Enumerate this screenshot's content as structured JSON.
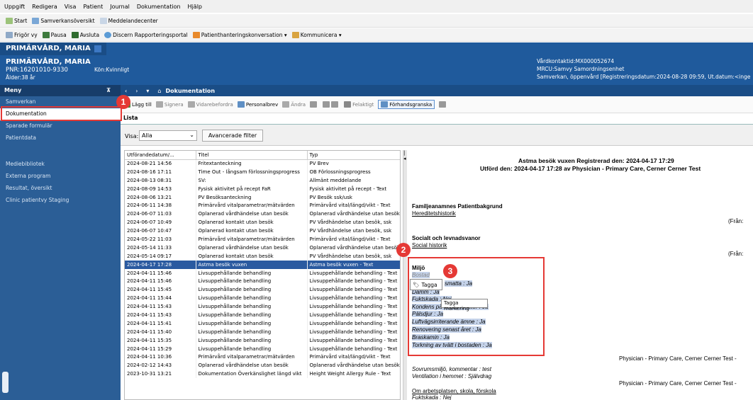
{
  "menubar": [
    "Uppgift",
    "Redigera",
    "Visa",
    "Patient",
    "Journal",
    "Dokumentation",
    "Hjälp"
  ],
  "toolbar1": [
    {
      "label": "Start",
      "icon": "home-icon"
    },
    {
      "label": "Samverkansöversikt",
      "icon": "overview-icon"
    },
    {
      "label": "Meddelandecenter",
      "icon": "message-icon"
    }
  ],
  "toolbar2": [
    {
      "label": "Frigör vy",
      "icon": "release-icon"
    },
    {
      "label": "Pausa",
      "icon": "pause-icon"
    },
    {
      "label": "Avsluta",
      "icon": "exit-icon"
    },
    {
      "label": "Discern Rapporteringsportal",
      "icon": "report-icon"
    },
    {
      "label": "Patienthanteringskonversation ▾",
      "icon": "patient-icon"
    },
    {
      "label": "Kommunicera ▾",
      "icon": "communicate-icon"
    }
  ],
  "banner": {
    "tab_name": "PRIMÄRVÅRD, MARIA",
    "patient_name": "PRIMÄRVÅRD, MARIA",
    "pnr": "PNR:16201010-9330",
    "kon": "Kön:Kvinnligt",
    "age": "Ålder:38 år",
    "vardkontakt": "Vårdkontaktid:MX000052674",
    "mrcu": "MRCU:Samvy Samordningsenhet",
    "samverkan": "Samverkan, öppenvård [Registreringsdatum:2024-08-28 09:59, Ut.datum:<inge"
  },
  "nav": {
    "header": "Meny",
    "pin": "⊼",
    "items": [
      "Samverkan",
      "Dokumentation",
      "Sparade formulär",
      "Patientdata",
      "Mediebibliotek",
      "Externa program",
      "Resultat, översikt",
      "Clinic patientvy Staging"
    ]
  },
  "crumb": {
    "back": "‹",
    "forward": "›",
    "dropdown": "▾",
    "home": "⌂",
    "title": "Dokumentation"
  },
  "doc_toolbar": {
    "add": "Lägg till",
    "sign": "Signera",
    "forward": "Vidarebefordra",
    "letter": "Personalbrev",
    "change": "Ändra",
    "incorrect": "Felaktigt",
    "preview": "Förhandsgranska"
  },
  "tab_lista": "Lista",
  "filter": {
    "label": "Visa:",
    "value": "Alla",
    "advanced": "Avancerade filter"
  },
  "table": {
    "headers": [
      "Utförandedatum/...",
      "Titel",
      "Typ"
    ],
    "rows": [
      [
        "2024-08-21 14:56",
        "Fritextanteckning",
        "PV Brev"
      ],
      [
        "2024-08-16 17:11",
        "Time Out - långsam förlossningsprogress",
        "OB Förlossningsprogress"
      ],
      [
        "2024-08-13 08:31",
        "SV:",
        "Allmänt meddelande"
      ],
      [
        "2024-08-09 14:53",
        "Fysisk aktivitet på recept FaR",
        "Fysisk aktivitet på recept - Text"
      ],
      [
        "2024-08-06 13:21",
        "PV Besöksanteckning",
        "PV Besök ssk/usk"
      ],
      [
        "2024-06-11 14:38",
        "Primärvård vitalparametrar/mätvärden",
        "Primärvård vital/längd/vikt - Text"
      ],
      [
        "2024-06-07 11:03",
        "Oplanerad vårdhändelse utan besök",
        "Oplanerad vårdhändelse utan besök -"
      ],
      [
        "2024-06-07 10:49",
        "Oplanerad kontakt utan besök",
        "PV Vårdhändelse utan besök, ssk"
      ],
      [
        "2024-06-07 10:47",
        "Oplanerad kontakt utan besök",
        "PV Vårdhändelse utan besök, ssk"
      ],
      [
        "2024-05-22 11:03",
        "Primärvård vitalparametrar/mätvärden",
        "Primärvård vital/längd/vikt - Text"
      ],
      [
        "2024-05-14 11:33",
        "Oplanerad vårdhändelse utan besök",
        "Oplanerad vårdhändelse utan besök"
      ],
      [
        "2024-05-14 09:17",
        "Oplanerad kontakt utan besök",
        "PV Vårdhändelse utan besök, ssk"
      ],
      [
        "2024-04-17 17:28",
        "Astma besök vuxen",
        "Astma besök vuxen - Text"
      ],
      [
        "2024-04-11 15:46",
        "Livsuppehållande behandling",
        "Livsuppehållande behandling - Text"
      ],
      [
        "2024-04-11 15:46",
        "Livsuppehållande behandling",
        "Livsuppehållande behandling - Text"
      ],
      [
        "2024-04-11 15:45",
        "Livsuppehållande behandling",
        "Livsuppehållande behandling - Text"
      ],
      [
        "2024-04-11 15:44",
        "Livsuppehållande behandling",
        "Livsuppehållande behandling - Text"
      ],
      [
        "2024-04-11 15:43",
        "Livsuppehållande behandling",
        "Livsuppehållande behandling - Text"
      ],
      [
        "2024-04-11 15:43",
        "Livsuppehållande behandling",
        "Livsuppehållande behandling - Text"
      ],
      [
        "2024-04-11 15:41",
        "Livsuppehållande behandling",
        "Livsuppehållande behandling - Text"
      ],
      [
        "2024-04-11 15:40",
        "Livsuppehållande behandling",
        "Livsuppehållande behandling - Text"
      ],
      [
        "2024-04-11 15:35",
        "Livsuppehållande behandling",
        "Livsuppehållande behandling - Text"
      ],
      [
        "2024-04-11 15:29",
        "Livsuppehållande behandling",
        "Livsuppehållande behandling - Text"
      ],
      [
        "2024-04-11 10:36",
        "Primärvård vitalparametrar/mätvärden",
        "Primärvård vital/längd/vikt - Text"
      ],
      [
        "2024-02-12 14:43",
        "Oplanerad vårdhändelse utan besök",
        "Oplanerad vårdhändelse utan besök -"
      ],
      [
        "2023-10-31 13:21",
        "Dokumentation Överkänslighet längd vikt",
        "Height Weight Allergy Rule - Text"
      ]
    ],
    "selected_index": 12
  },
  "preview": {
    "title1": "Astma besök vuxen Registrerad den:  2024-04-17 17:29",
    "title2": "Utförd den:  2024-04-17 17:28  av Physician - Primary Care, Cerner Cerner Test",
    "section1": "Familjeanamnes Patientbakgrund",
    "link1": "Hereditetshistorik",
    "fran1": "(Från: ",
    "section2": "Socialt och levnadsvanor",
    "link2": "Social historik",
    "fran2": "(Från: ",
    "section3": "Miljö",
    "hidden_row": "Bostad",
    "env_items": [
      "smatta :  Ja",
      "Damm :  Ja",
      "Fuktskada :  Nej",
      "Kondens på insida fönster :  Ja",
      "Pälsdjur :  Ja",
      "Luftvägsirriterande ämne :  Ja",
      "Renovering senast året :  Ja",
      "Braskamin :  Ja",
      "Torkning av tvätt i bostaden :  Ja"
    ],
    "physician1": "Physician - Primary Care, Cerner Cerner Test -",
    "sovrum": "Sovrumsmiljö, kommentar :  test",
    "ventilation": "Ventilation i hemmet :  Självdrag",
    "physician2": "Physician - Primary Care, Cerner Cerner Test -",
    "arbetsplats": "Om arbetsplatsen, skola, förskola",
    "fuktskada2": "Fuktskada :  Nej"
  },
  "tag_button": "Tagga",
  "tooltip": "Tagga markering",
  "badges": [
    "1",
    "2",
    "3"
  ]
}
